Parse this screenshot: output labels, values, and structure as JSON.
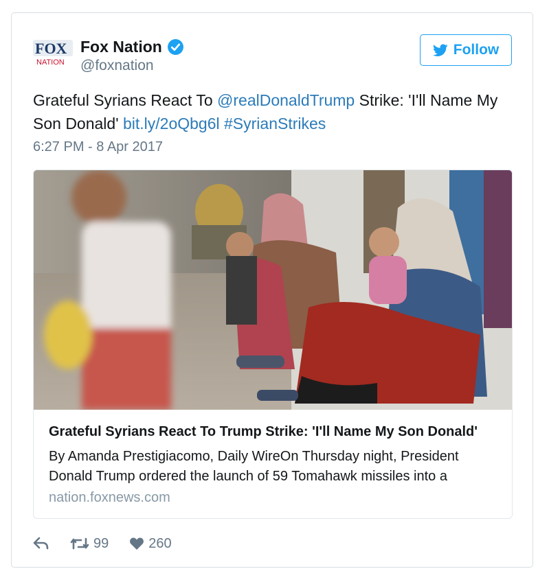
{
  "author": {
    "name": "Fox Nation",
    "handle": "@foxnation",
    "logo_text_top": "FOX",
    "logo_text_bottom": "NATION",
    "verified": true
  },
  "follow_button": {
    "label": "Follow",
    "icon": "twitter-bird-icon"
  },
  "tweet": {
    "text_part1": "Grateful Syrians React To ",
    "mention": "@realDonaldTrump",
    "text_part2": " Strike: 'I'll Name My Son Donald' ",
    "link": "bit.ly/2oQbg6l",
    "text_part3": " ",
    "hashtag": "#SyrianStrikes",
    "timestamp": "6:27 PM - 8 Apr 2017"
  },
  "card": {
    "title": "Grateful Syrians React To Trump Strike: 'I'll Name My Son Donald'",
    "description": "By Amanda Prestigiacomo, Daily WireOn Thursday night, President Donald Trump ordered the launch of 59 Tomahawk missiles into a",
    "domain": "nation.foxnews.com"
  },
  "actions": {
    "reply_icon": "reply-icon",
    "retweet_icon": "retweet-icon",
    "retweet_count": "99",
    "like_icon": "heart-icon",
    "like_count": "260"
  },
  "colors": {
    "link_blue": "#2b7bb9",
    "twitter_blue": "#1da1f2",
    "muted_gray": "#657786"
  }
}
